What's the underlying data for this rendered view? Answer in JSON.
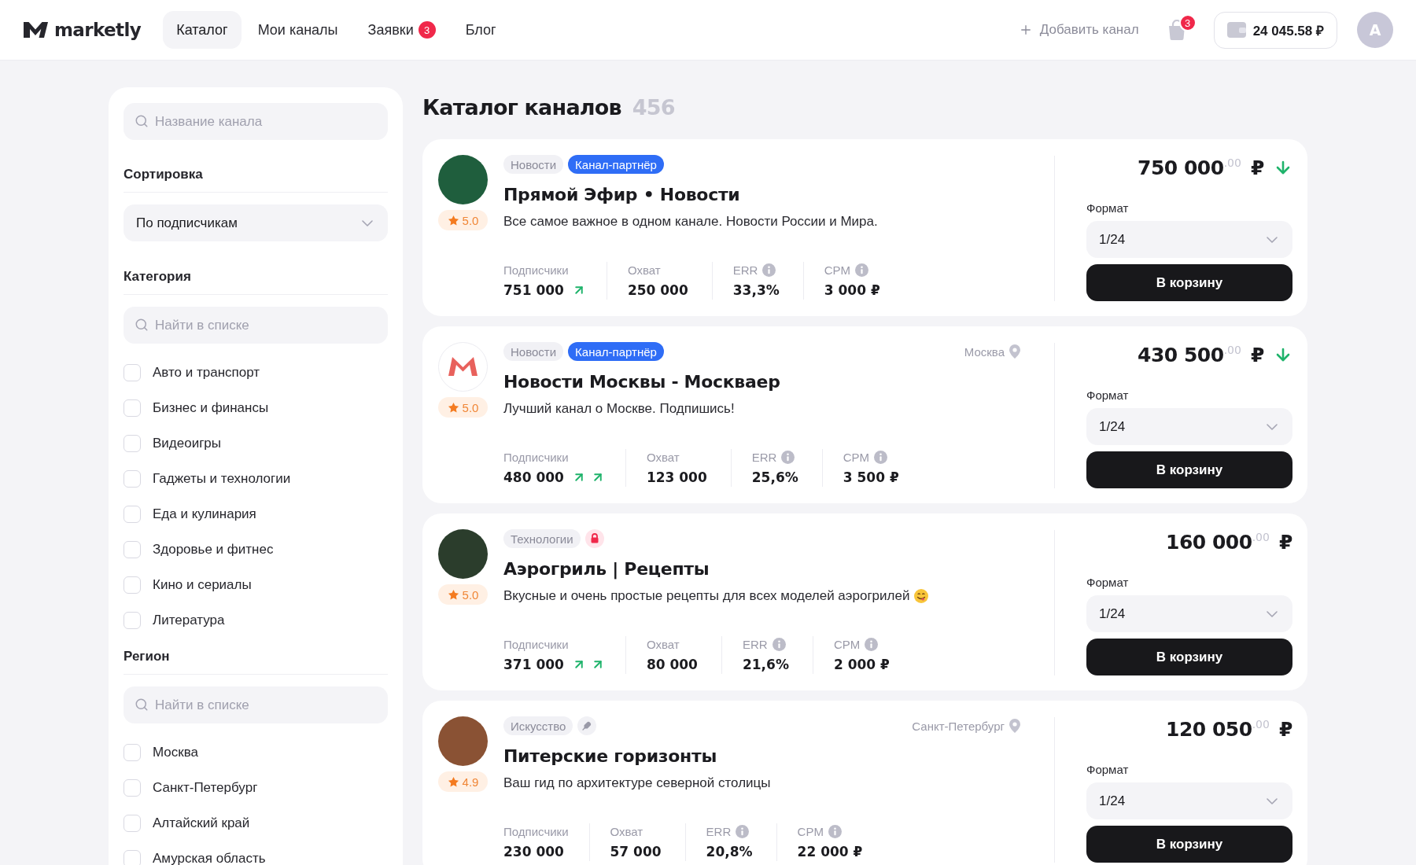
{
  "header": {
    "logo": "marketly",
    "nav": [
      {
        "label": "Каталог",
        "selected": true
      },
      {
        "label": "Мои каналы",
        "selected": false
      },
      {
        "label": "Заявки",
        "selected": false,
        "badge": "3"
      },
      {
        "label": "Блог",
        "selected": false
      }
    ],
    "add_channel": "Добавить канал",
    "cart_badge": "3",
    "balance": "24 045.58 ₽",
    "avatar_initial": "A"
  },
  "sidebar": {
    "search": {
      "placeholder": "Название канала"
    },
    "sections": [
      {
        "kind": "select",
        "title": "Сортировка",
        "value": "По подписчикам"
      },
      {
        "kind": "checklist",
        "title": "Категория",
        "search": {
          "placeholder": "Найти в списке"
        },
        "items": [
          {
            "label": "Авто и транспорт",
            "checked": false
          },
          {
            "label": "Бизнес и финансы",
            "checked": false
          },
          {
            "label": "Видеоигры",
            "checked": false
          },
          {
            "label": "Гаджеты и технологии",
            "checked": false
          },
          {
            "label": "Еда и кулинария",
            "checked": false
          },
          {
            "label": "Здоровье и фитнес",
            "checked": false
          },
          {
            "label": "Кино и сериалы",
            "checked": false
          },
          {
            "label": "Литература",
            "checked": false
          }
        ]
      },
      {
        "kind": "checklist",
        "title": "Регион",
        "search": {
          "placeholder": "Найти в списке"
        },
        "items": [
          {
            "label": "Москва",
            "checked": false
          },
          {
            "label": "Санкт-Петербург",
            "checked": false
          },
          {
            "label": "Алтайский край",
            "checked": false
          },
          {
            "label": "Амурская область",
            "checked": false
          }
        ]
      }
    ]
  },
  "catalog": {
    "title": "Каталог каналов",
    "count": "456",
    "channels": [
      {
        "avatar": {
          "kind": "photo",
          "color": "#1f5e3d"
        },
        "rating": "5.0",
        "tags": [
          {
            "kind": "category",
            "label": "Новости"
          },
          {
            "kind": "partner",
            "label": "Канал-партнёр"
          }
        ],
        "title": "Прямой Эфир • Новости",
        "description": "Все самое важное в одном канале. Новости России и Мира.",
        "emoji": false,
        "stats": [
          {
            "label": "Подписчики",
            "value": "751 000",
            "arrows": [
              {
                "kind": "up"
              }
            ],
            "info": false
          },
          {
            "label": "Охват",
            "value": "250 000",
            "info": false
          },
          {
            "label": "ERR",
            "value": "33,3%",
            "info": true
          },
          {
            "label": "CPM",
            "value": "3 000 ₽",
            "info": true
          }
        ],
        "price": "750 000$^{.00}$ ₽",
        "price_down": true,
        "format": {
          "label": "Формат",
          "value": "1/24"
        },
        "button": "В корзину"
      },
      {
        "avatar": {
          "kind": "logo",
          "color": "#e8615c"
        },
        "rating": "5.0",
        "tags": [
          {
            "kind": "category",
            "label": "Новости"
          },
          {
            "kind": "partner",
            "label": "Канал-партнёр"
          }
        ],
        "location": "Москва",
        "title": "Новости Москвы - Москваер",
        "description": "Лучший канал о Москве. Подпишись!",
        "emoji": false,
        "stats": [
          {
            "label": "Подписчики",
            "value": "480 000",
            "arrows": [
              {
                "kind": "up"
              },
              {
                "kind": "up"
              }
            ],
            "info": false
          },
          {
            "label": "Охват",
            "value": "123 000",
            "info": false
          },
          {
            "label": "ERR",
            "value": "25,6%",
            "info": true
          },
          {
            "label": "CPM",
            "value": "3 500 ₽",
            "info": true
          }
        ],
        "price": "430 500$^{.00}$ ₽",
        "price_down": true,
        "format": {
          "label": "Формат",
          "value": "1/24"
        },
        "button": "В корзину"
      },
      {
        "avatar": {
          "kind": "photo",
          "color": "#2b3d2c"
        },
        "rating": "5.0",
        "tags": [
          {
            "kind": "category",
            "label": "Технологии"
          },
          {
            "kind": "lock"
          }
        ],
        "title": "Аэрогриль | Рецепты",
        "description": "Вкусные и очень простые рецепты для всех моделей аэрогрилей",
        "emoji": true,
        "stats": [
          {
            "label": "Подписчики",
            "value": "371 000",
            "arrows": [
              {
                "kind": "up"
              },
              {
                "kind": "up"
              }
            ],
            "info": false
          },
          {
            "label": "Охват",
            "value": "80 000",
            "info": false
          },
          {
            "label": "ERR",
            "value": "21,6%",
            "info": true
          },
          {
            "label": "CPM",
            "value": "2 000 ₽",
            "info": true
          }
        ],
        "price": "160 000$^{.00}$ ₽",
        "price_down": false,
        "format": {
          "label": "Формат",
          "value": "1/24"
        },
        "button": "В корзину"
      },
      {
        "avatar": {
          "kind": "photo",
          "color": "#8a5234"
        },
        "rating": "4.9",
        "tags": [
          {
            "kind": "category",
            "label": "Искусство"
          },
          {
            "kind": "feather"
          }
        ],
        "location": "Санкт-Петербург",
        "title": "Питерские горизонты",
        "description": "Ваш гид по архитектуре северной столицы",
        "emoji": false,
        "stats": [
          {
            "label": "Подписчики",
            "value": "230 000",
            "info": false
          },
          {
            "label": "Охват",
            "value": "57 000",
            "info": false
          },
          {
            "label": "ERR",
            "value": "20,8%",
            "info": true
          },
          {
            "label": "CPM",
            "value": "22 000 ₽",
            "info": true
          }
        ],
        "price": "120 050$^{.00}$ ₽",
        "price_down": false,
        "format": {
          "label": "Формат",
          "value": "1/24"
        },
        "button": "В корзину"
      }
    ]
  }
}
